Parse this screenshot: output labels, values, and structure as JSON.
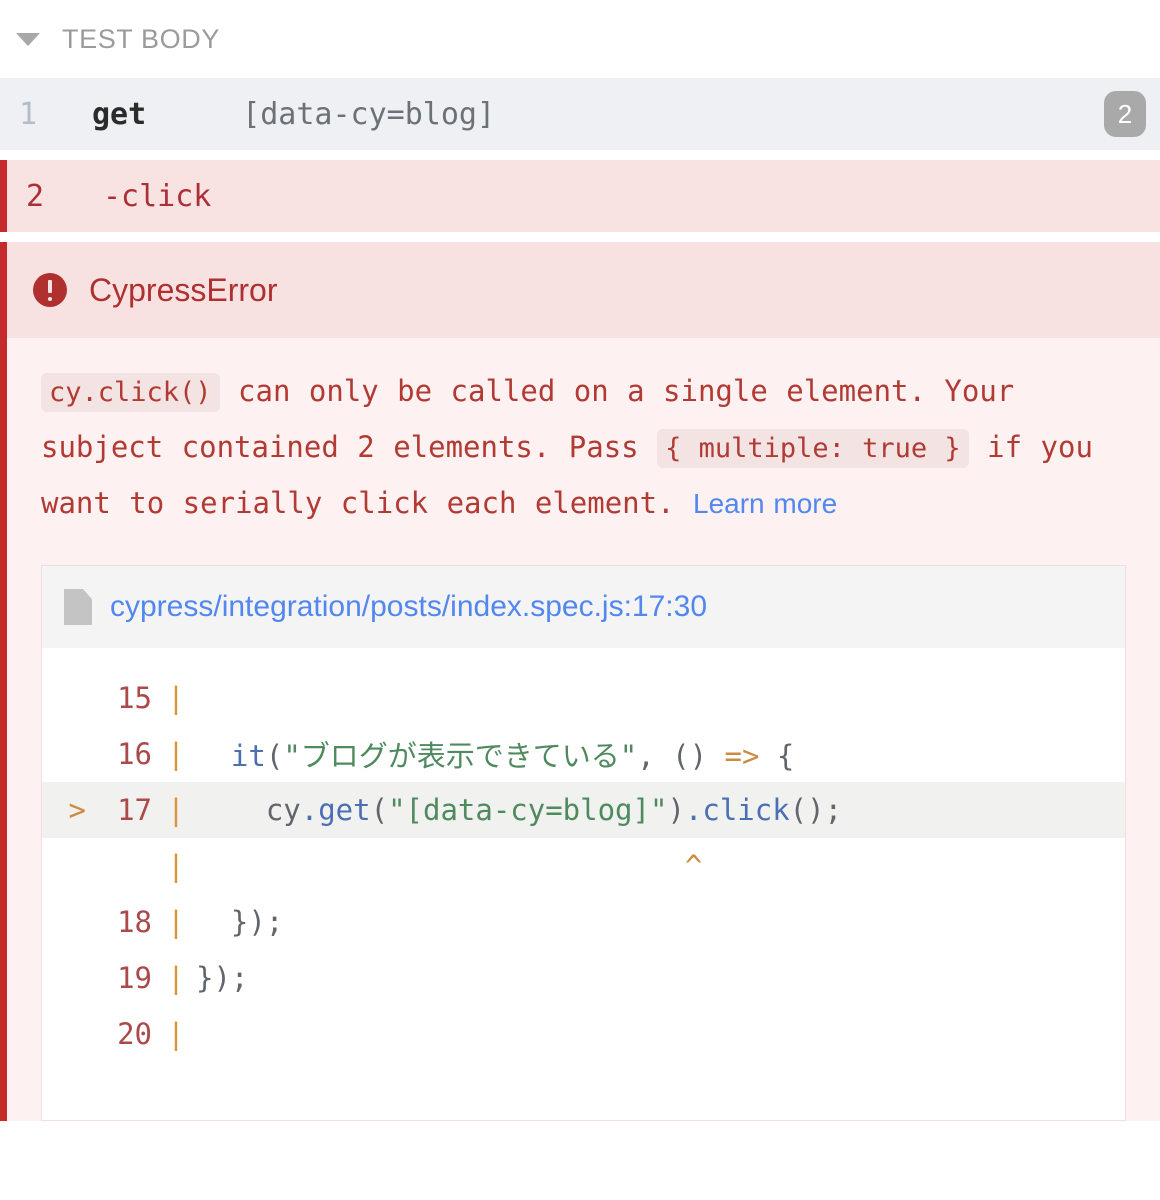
{
  "header": {
    "title": "TEST BODY",
    "caret_icon": "chevron-down-icon"
  },
  "commands": [
    {
      "number": "1",
      "name": "get",
      "argument": "[data-cy=blog]",
      "badge": "2",
      "state": "passed"
    },
    {
      "number": "2",
      "name": "-click",
      "argument": "",
      "badge": "",
      "state": "failed"
    }
  ],
  "error": {
    "icon": "error-circle-icon",
    "title": "CypressError",
    "message_parts": {
      "code1": "cy.click()",
      "text1": " can only be called on a single element. Your subject contained 2 elements. Pass ",
      "code2": "{ multiple: true }",
      "text2": " if you want to serially click each element. ",
      "link": "Learn more"
    }
  },
  "code_frame": {
    "file_icon": "file-document-icon",
    "file_path": "cypress/integration/posts/index.spec.js:17:30",
    "lines": [
      {
        "marker": "",
        "number": "15",
        "pipe": "|",
        "highlight": false,
        "segments": []
      },
      {
        "marker": "",
        "number": "16",
        "pipe": "|",
        "highlight": false,
        "segments": [
          {
            "text": "  it",
            "cls": "tok-fn"
          },
          {
            "text": "(",
            "cls": "tok-plain"
          },
          {
            "text": "\"ブログが表示できている\"",
            "cls": "tok-str"
          },
          {
            "text": ", () ",
            "cls": "tok-plain"
          },
          {
            "text": "=>",
            "cls": "tok-arrow"
          },
          {
            "text": " {",
            "cls": "tok-plain"
          }
        ]
      },
      {
        "marker": ">",
        "number": "17",
        "pipe": "|",
        "highlight": true,
        "segments": [
          {
            "text": "    cy",
            "cls": "tok-plain"
          },
          {
            "text": ".get",
            "cls": "tok-fn"
          },
          {
            "text": "(",
            "cls": "tok-plain"
          },
          {
            "text": "\"[data-cy=blog]\"",
            "cls": "tok-str"
          },
          {
            "text": ")",
            "cls": "tok-plain"
          },
          {
            "text": ".click",
            "cls": "tok-fn"
          },
          {
            "text": "();",
            "cls": "tok-plain"
          }
        ]
      },
      {
        "marker": "",
        "number": "",
        "pipe": "|",
        "highlight": false,
        "segments": [
          {
            "text": "                            ^",
            "cls": "tok-caret"
          }
        ]
      },
      {
        "marker": "",
        "number": "18",
        "pipe": "|",
        "highlight": false,
        "segments": [
          {
            "text": "  });",
            "cls": "tok-plain"
          }
        ]
      },
      {
        "marker": "",
        "number": "19",
        "pipe": "|",
        "highlight": false,
        "segments": [
          {
            "text": "});",
            "cls": "tok-plain"
          }
        ]
      },
      {
        "marker": "",
        "number": "20",
        "pipe": "|",
        "highlight": false,
        "segments": []
      }
    ]
  },
  "colors": {
    "error_red": "#b03030",
    "link_blue": "#5187ef",
    "failed_bg": "#f9e2e2",
    "passed_bg": "#eef0f4",
    "accent_orange": "#cc8b42"
  }
}
